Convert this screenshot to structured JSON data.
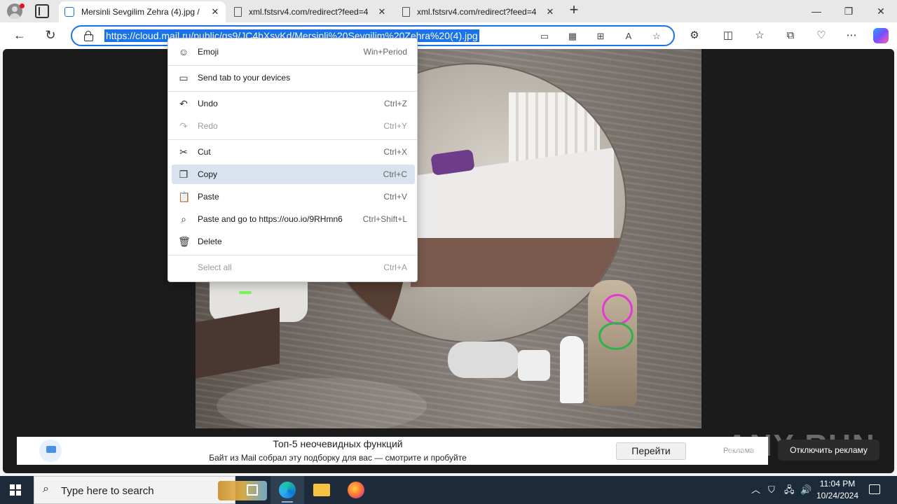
{
  "browser": {
    "tabs": [
      {
        "title": "Mersinli Sevgilim Zehra (4).jpg / ",
        "active": true
      },
      {
        "title": "xml.fstsrv4.com/redirect?feed=4",
        "active": false
      },
      {
        "title": "xml.fstsrv4.com/redirect?feed=4",
        "active": false
      }
    ],
    "url": "https://cloud.mail.ru/public/qs9/JC4bXsvKd/Mersinli%20Sevgilim%20Zehra%20(4).jpg",
    "accent_color": "#1a73e8"
  },
  "context_menu": {
    "items": [
      {
        "icon": "emoji-icon",
        "label": "Emoji",
        "shortcut": "Win+Period",
        "disabled": false,
        "highlighted": false
      },
      {
        "icon": "send-tab-icon",
        "label": "Send tab to your devices",
        "shortcut": "",
        "disabled": false,
        "highlighted": false
      },
      {
        "icon": "undo-icon",
        "label": "Undo",
        "shortcut": "Ctrl+Z",
        "disabled": false,
        "highlighted": false
      },
      {
        "icon": "redo-icon",
        "label": "Redo",
        "shortcut": "Ctrl+Y",
        "disabled": true,
        "highlighted": false
      },
      {
        "icon": "cut-icon",
        "label": "Cut",
        "shortcut": "Ctrl+X",
        "disabled": false,
        "highlighted": false
      },
      {
        "icon": "copy-icon",
        "label": "Copy",
        "shortcut": "Ctrl+C",
        "disabled": false,
        "highlighted": true
      },
      {
        "icon": "paste-icon",
        "label": "Paste",
        "shortcut": "Ctrl+V",
        "disabled": false,
        "highlighted": false
      },
      {
        "icon": "paste-go-icon",
        "label": "Paste and go to https://ouo.io/9RHmn6",
        "shortcut": "Ctrl+Shift+L",
        "disabled": false,
        "highlighted": false
      },
      {
        "icon": "delete-icon",
        "label": "Delete",
        "shortcut": "",
        "disabled": false,
        "highlighted": false
      },
      {
        "icon": "",
        "label": "Select all",
        "shortcut": "Ctrl+A",
        "disabled": true,
        "highlighted": false
      }
    ]
  },
  "ad": {
    "title": "Топ-5 неочевидных функций",
    "text": "Байт из Mail собрал эту подборку для вас — смотрите и пробуйте",
    "button": "Перейти",
    "label": "Реклама",
    "disable": "Отключить рекламу"
  },
  "watermark": "ANY RUN",
  "taskbar": {
    "search_placeholder": "Type here to search",
    "time": "11:04 PM",
    "date": "10/24/2024"
  }
}
